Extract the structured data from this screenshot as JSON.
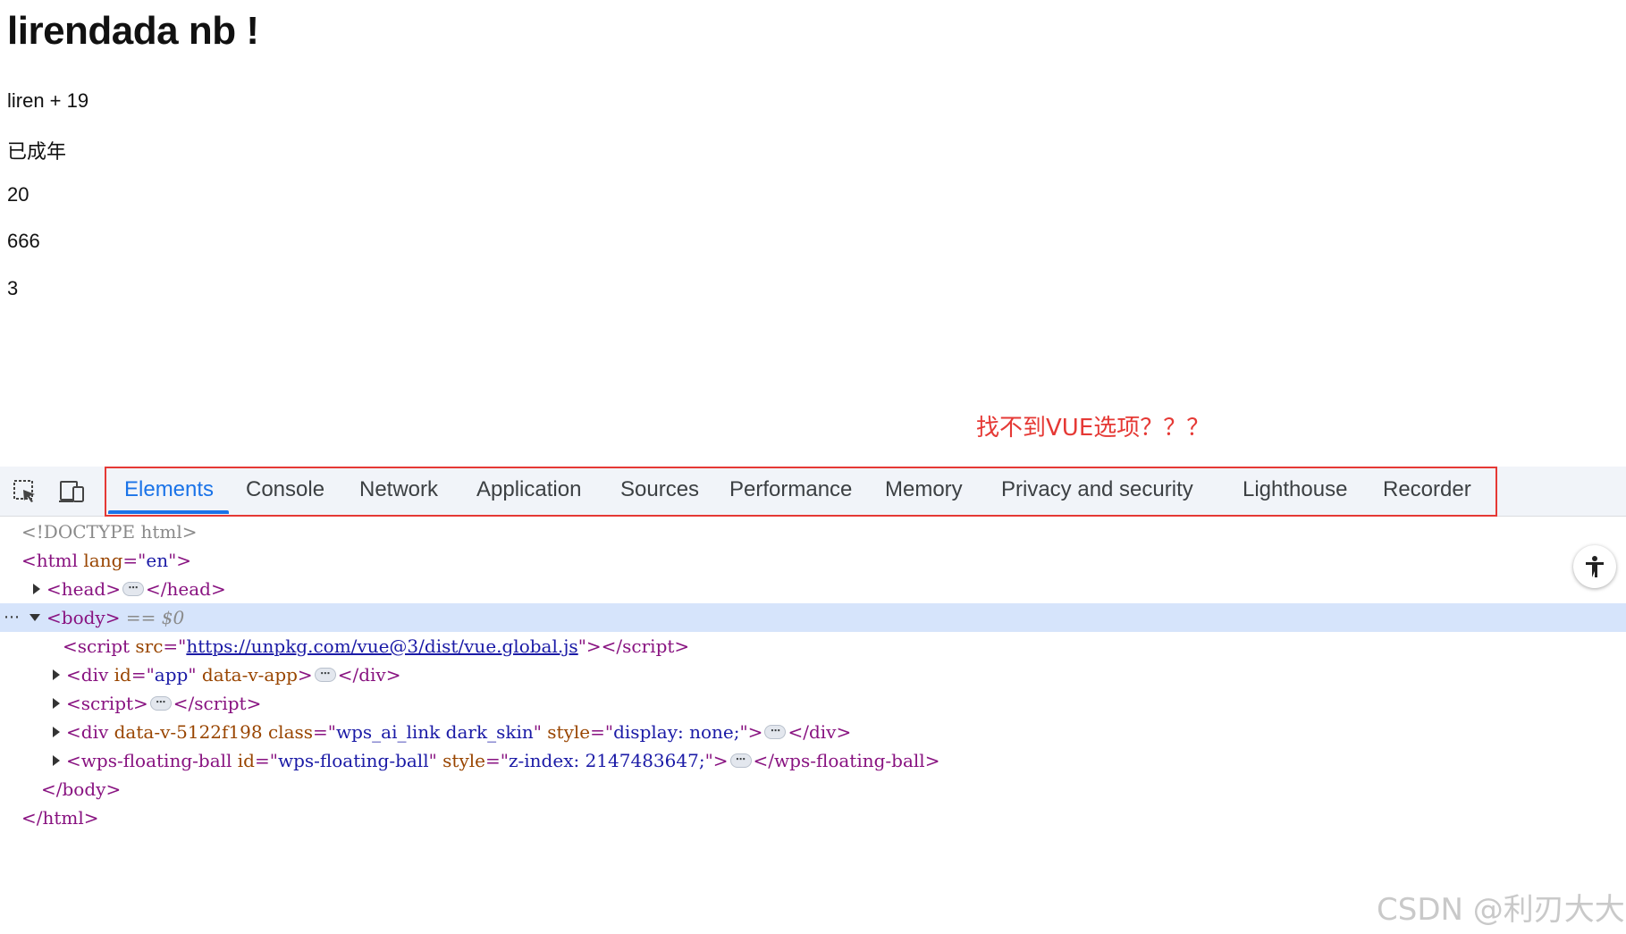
{
  "page": {
    "heading": "lirendada nb !",
    "paragraphs": [
      "liren + 19",
      "已成年",
      "20",
      "666",
      "3"
    ],
    "annotation": "找不到VUE选项？？？"
  },
  "devtools": {
    "toolbar": {
      "icons": [
        "inspect-element-icon",
        "device-toolbar-icon"
      ],
      "tabs": [
        {
          "label": "Elements",
          "active": true
        },
        {
          "label": "Console"
        },
        {
          "label": "Network"
        },
        {
          "label": "Application"
        },
        {
          "label": "Sources"
        },
        {
          "label": "Performance"
        },
        {
          "label": "Memory"
        },
        {
          "label": "Privacy and security"
        },
        {
          "label": "Lighthouse"
        },
        {
          "label": "Recorder"
        }
      ]
    },
    "dom": {
      "doctype": "<!DOCTYPE html>",
      "html_open": {
        "tag": "html",
        "attr": "lang",
        "value": "en"
      },
      "head": {
        "tag": "head"
      },
      "body": {
        "tag": "body",
        "marker": "== $0"
      },
      "script_src": {
        "tag": "script",
        "attr": "src",
        "value": "https://unpkg.com/vue@3/dist/vue.global.js"
      },
      "div_app": {
        "tag": "div",
        "attr1": "id",
        "val1": "app",
        "attr2": "data-v-app"
      },
      "script_inline": {
        "tag": "script"
      },
      "div_wps": {
        "tag": "div",
        "attr1": "data-v-5122f198",
        "attr2": "class",
        "val2": "wps_ai_link dark_skin",
        "attr3": "style",
        "val3": "display: none;"
      },
      "floating_ball": {
        "tag": "wps-floating-ball",
        "attr1": "id",
        "val1": "wps-floating-ball",
        "attr2": "style",
        "val2": "z-index: 2147483647;"
      },
      "body_close": "</body>",
      "html_close": "</html>"
    },
    "ellipsis": "⋯",
    "row_menu": "⋯",
    "accessibility_icon": "accessibility-icon",
    "colors": {
      "accent": "#1a73e8",
      "highlight_box": "#e53935",
      "selected_row": "#d6e4fb"
    }
  },
  "watermark": "CSDN @利刃大大"
}
